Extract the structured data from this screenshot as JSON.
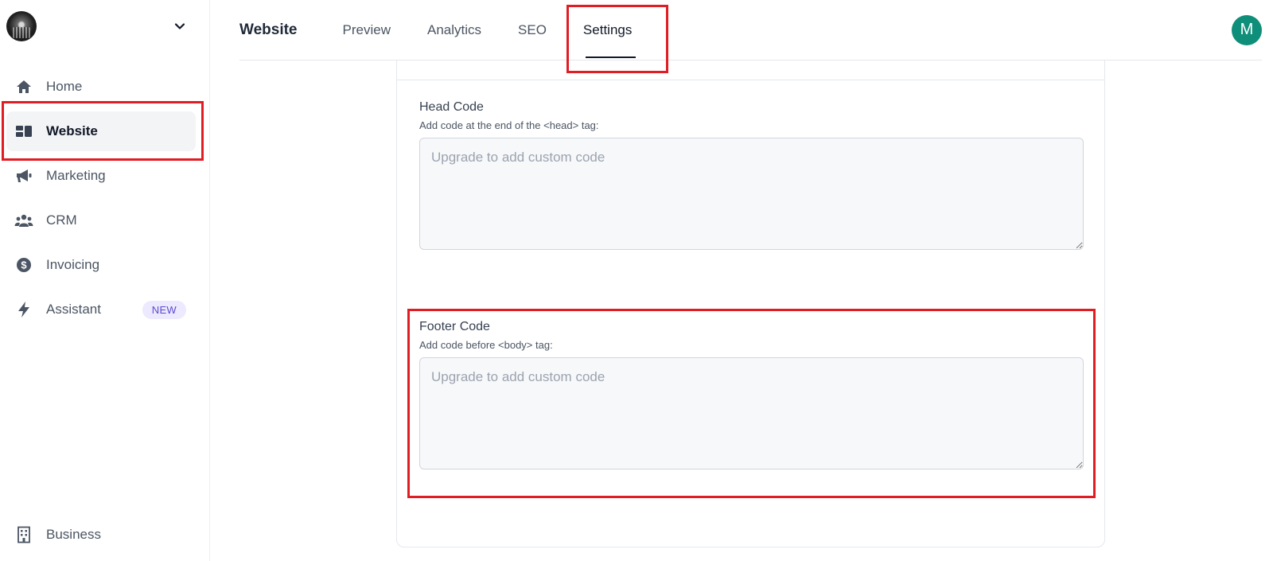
{
  "sidebar": {
    "workspace_menu_icon": "chevron-down-icon",
    "items": [
      {
        "label": "Home",
        "icon": "home-icon"
      },
      {
        "label": "Website",
        "icon": "website-icon",
        "active": true
      },
      {
        "label": "Marketing",
        "icon": "megaphone-icon"
      },
      {
        "label": "CRM",
        "icon": "people-icon"
      },
      {
        "label": "Invoicing",
        "icon": "dollar-icon"
      },
      {
        "label": "Assistant",
        "icon": "bolt-icon",
        "badge": "NEW"
      }
    ],
    "footer_item": {
      "label": "Business",
      "icon": "building-icon"
    }
  },
  "header": {
    "title": "Website",
    "tabs": [
      {
        "label": "Preview"
      },
      {
        "label": "Analytics"
      },
      {
        "label": "SEO"
      },
      {
        "label": "Settings",
        "active": true
      }
    ],
    "user_initial": "M"
  },
  "settings": {
    "head_code": {
      "label": "Head Code",
      "help": "Add code at the end of the <head> tag:",
      "placeholder": "Upgrade to add custom code",
      "value": ""
    },
    "footer_code": {
      "label": "Footer Code",
      "help": "Add code before <body> tag:",
      "placeholder": "Upgrade to add custom code",
      "value": ""
    }
  },
  "colors": {
    "highlight": "#e11d24",
    "avatar": "#0f8f7a",
    "badge_bg": "#ede9fe",
    "badge_text": "#5b4bd1"
  }
}
